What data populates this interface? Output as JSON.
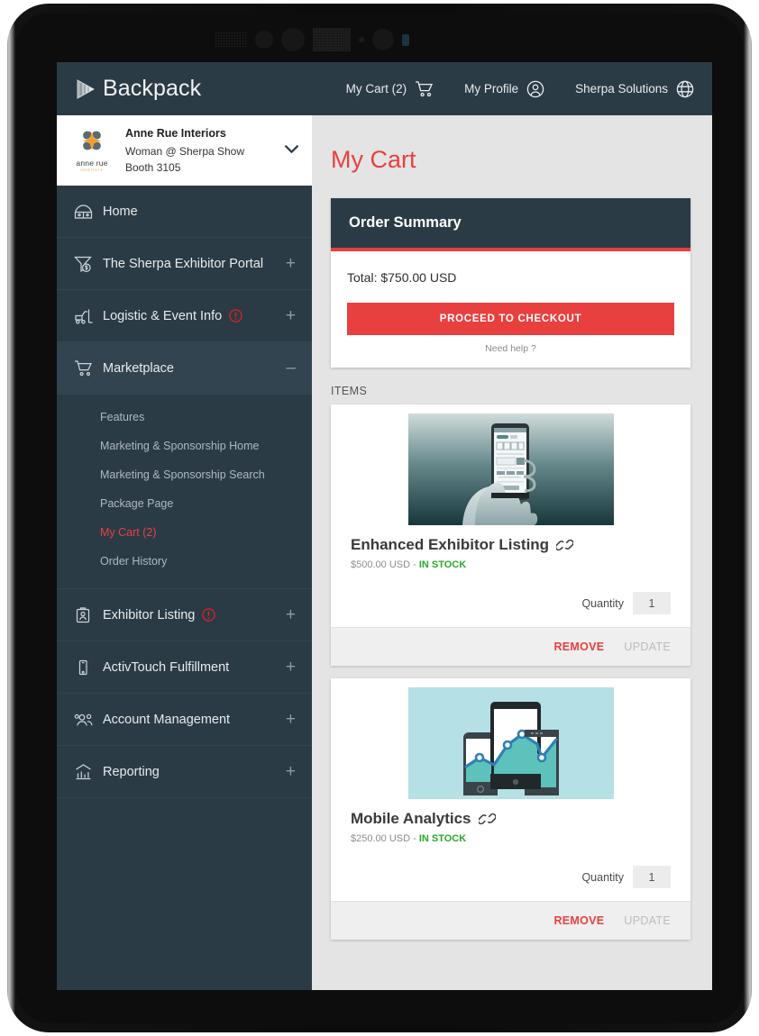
{
  "header": {
    "brand": "Backpack",
    "brand_icon": "play-triangle-icon",
    "nav": [
      {
        "label": "My Cart (2)",
        "icon": "shopping-cart-icon"
      },
      {
        "label": "My Profile",
        "icon": "user-circle-icon"
      },
      {
        "label": "Sherpa Solutions",
        "icon": "globe-icon"
      }
    ]
  },
  "sidebar": {
    "company": {
      "logo_word": "anne rue",
      "logo_sub": "interiors",
      "name": "Anne Rue Interiors",
      "line2": "Woman @ Sherpa Show",
      "line3": "Booth 3105",
      "caret_icon": "chevron-down-icon"
    },
    "items": [
      {
        "label": "Home",
        "icon": "home-icon",
        "toggle": "",
        "alert": false
      },
      {
        "label": "The Sherpa Exhibitor Portal",
        "icon": "funnel-dollar-icon",
        "toggle": "+",
        "alert": false
      },
      {
        "label": "Logistic & Event Info",
        "icon": "forklift-icon",
        "toggle": "+",
        "alert": true
      },
      {
        "label": "Marketplace",
        "icon": "shopping-cart-icon",
        "toggle": "–",
        "alert": false
      },
      {
        "label": "Exhibitor Listing",
        "icon": "id-badge-icon",
        "toggle": "+",
        "alert": true
      },
      {
        "label": "ActivTouch Fulfillment",
        "icon": "mobile-device-icon",
        "toggle": "+",
        "alert": false
      },
      {
        "label": "Account Management",
        "icon": "users-icon",
        "toggle": "+",
        "alert": false
      },
      {
        "label": "Reporting",
        "icon": "bar-chart-icon",
        "toggle": "+",
        "alert": false
      }
    ],
    "marketplace_submenu": [
      {
        "label": "Features",
        "current": false
      },
      {
        "label": "Marketing & Sponsorship Home",
        "current": false
      },
      {
        "label": "Marketing & Sponsorship Search",
        "current": false
      },
      {
        "label": "Package Page",
        "current": false
      },
      {
        "label": "My Cart (2)",
        "current": true
      },
      {
        "label": "Order History",
        "current": false
      }
    ]
  },
  "main": {
    "page_title": "My Cart",
    "summary": {
      "heading": "Order Summary",
      "total": "Total: $750.00 USD",
      "checkout_label": "PROCEED TO CHECKOUT",
      "need_help": "Need help ?"
    },
    "items_label": "ITEMS",
    "items": [
      {
        "title": "Enhanced Exhibitor Listing",
        "link_icon": "chain-link-icon",
        "price": "$500.00 USD - ",
        "stock": "IN STOCK",
        "qty_label": "Quantity",
        "qty_value": "1",
        "remove_label": "REMOVE",
        "update_label": "UPDATE",
        "image": "hands-holding-phone-photo"
      },
      {
        "title": "Mobile Analytics",
        "link_icon": "chain-link-icon",
        "price": "$250.00 USD - ",
        "stock": "IN STOCK",
        "qty_label": "Quantity",
        "qty_value": "1",
        "remove_label": "REMOVE",
        "update_label": "UPDATE",
        "image": "devices-analytics-chart-illustration"
      }
    ]
  },
  "colors": {
    "accent_red": "#e8403f",
    "dark_slate": "#2b3b46",
    "stock_green": "#2aa92a",
    "page_bg": "#e4e4e4"
  }
}
